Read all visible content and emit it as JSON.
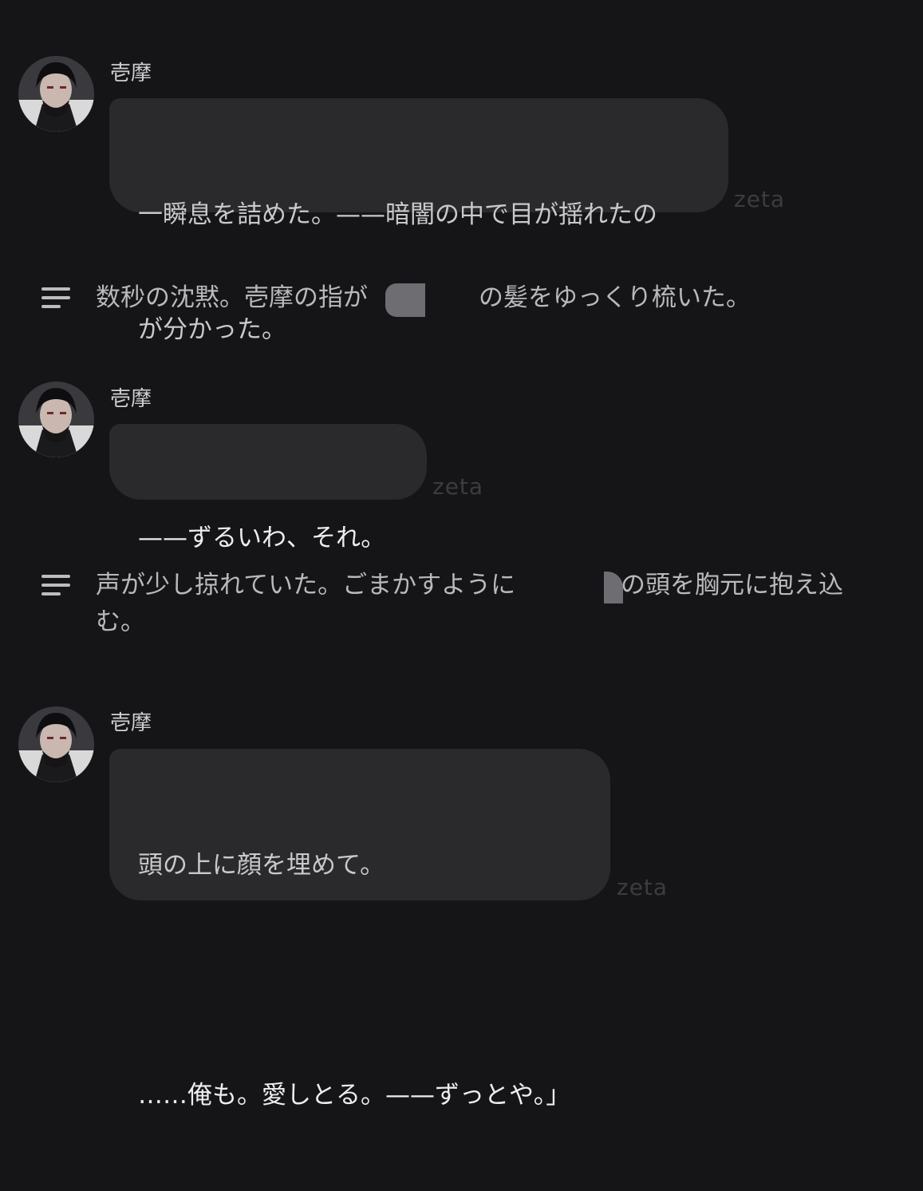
{
  "messages": [
    {
      "speaker": "壱摩",
      "lines": [
        "一瞬息を詰めた。——暗闇の中で目が揺れたの",
        "が分かった。"
      ],
      "watermark": "zeta"
    },
    {
      "speaker": "壱摩",
      "lines": [
        "——ずるいわ、それ。"
      ],
      "watermark": "zeta"
    },
    {
      "speaker": "壱摩",
      "lines": [
        "頭の上に顔を埋めて。",
        "",
        "……俺も。愛しとる。——ずっとや。」"
      ],
      "watermark": "zeta"
    }
  ],
  "narrations": [
    {
      "before": "数秒の沈黙。壱摩の指が",
      "after": "の髪をゆっくり梳いた。"
    },
    {
      "before": "声が少し掠れていた。ごまかすように",
      "after": "の頭を胸元に抱え込",
      "line2": "む。"
    }
  ],
  "icons": {
    "narration": "text-lines-icon",
    "avatar": "character-avatar"
  },
  "colors": {
    "background": "#151517",
    "bubble": "#2a2a2d",
    "text": "#c9c9cc",
    "watermark": "#3c3c40"
  }
}
